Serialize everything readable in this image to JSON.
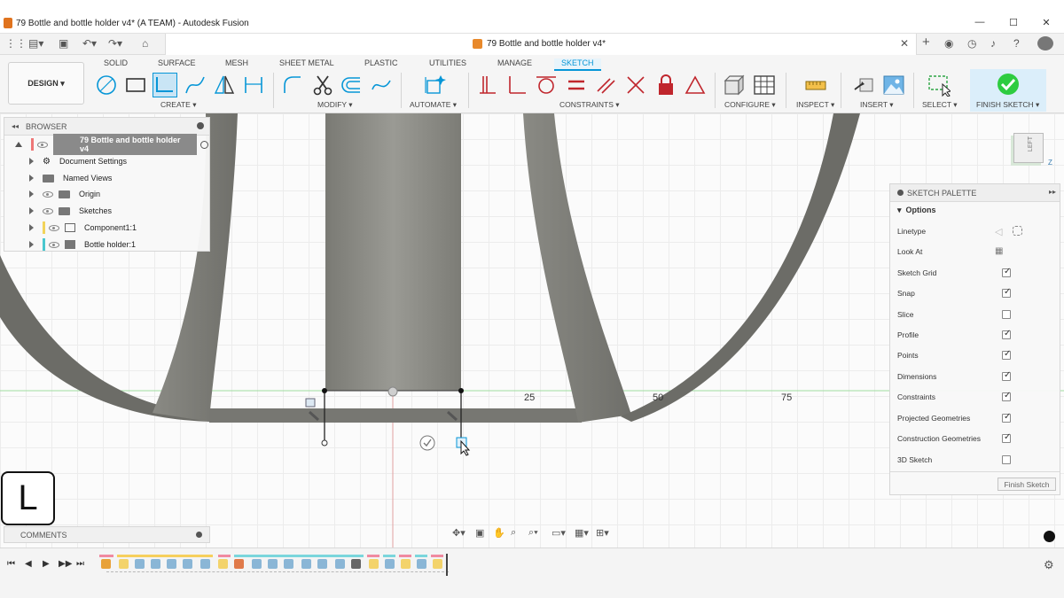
{
  "window": {
    "title": "79 Bottle and bottle holder v4* (A TEAM) - Autodesk Fusion",
    "minimize": "—",
    "maximize": "☐",
    "close": "✕"
  },
  "document_tab": {
    "title": "79 Bottle and bottle holder v4*",
    "close": "✕"
  },
  "workspace": {
    "label": "DESIGN",
    "chevron": "▾"
  },
  "ribbon_tabs": [
    "SOLID",
    "SURFACE",
    "MESH",
    "SHEET METAL",
    "PLASTIC",
    "UTILITIES",
    "MANAGE",
    "SKETCH"
  ],
  "ribbon_groups": {
    "create": "CREATE ▾",
    "modify": "MODIFY ▾",
    "automate": "AUTOMATE ▾",
    "constraints": "CONSTRAINTS ▾",
    "configure": "CONFIGURE ▾",
    "inspect": "INSPECT ▾",
    "insert": "INSERT ▾",
    "select": "SELECT ▾",
    "finish": "FINISH SKETCH ▾"
  },
  "browser": {
    "title": "BROWSER",
    "root": "79 Bottle and bottle holder v4",
    "items": [
      "Document Settings",
      "Named Views",
      "Origin",
      "Sketches",
      "Component1:1",
      "Bottle holder:1"
    ]
  },
  "sketch_palette": {
    "title": "SKETCH PALETTE",
    "section": "Options",
    "rows": [
      {
        "label": "Linetype"
      },
      {
        "label": "Look At"
      },
      {
        "label": "Sketch Grid",
        "checked": true
      },
      {
        "label": "Snap",
        "checked": true
      },
      {
        "label": "Slice",
        "checked": false
      },
      {
        "label": "Profile",
        "checked": true
      },
      {
        "label": "Points",
        "checked": true
      },
      {
        "label": "Dimensions",
        "checked": true
      },
      {
        "label": "Constraints",
        "checked": true
      },
      {
        "label": "Projected Geometries",
        "checked": true
      },
      {
        "label": "Construction Geometries",
        "checked": true
      },
      {
        "label": "3D Sketch",
        "checked": false
      }
    ],
    "finish_button": "Finish Sketch"
  },
  "viewcube": {
    "face": "LEFT",
    "axis": "Z"
  },
  "dimensions": [
    "25",
    "50",
    "75"
  ],
  "comments": {
    "title": "COMMENTS"
  },
  "key_overlay": "L",
  "colors": {
    "accent": "#0696d7",
    "finish": "#2ecc40",
    "body": "#8a8a85",
    "x_axis": "#7ed07e",
    "y_axis": "#d98a8a"
  }
}
